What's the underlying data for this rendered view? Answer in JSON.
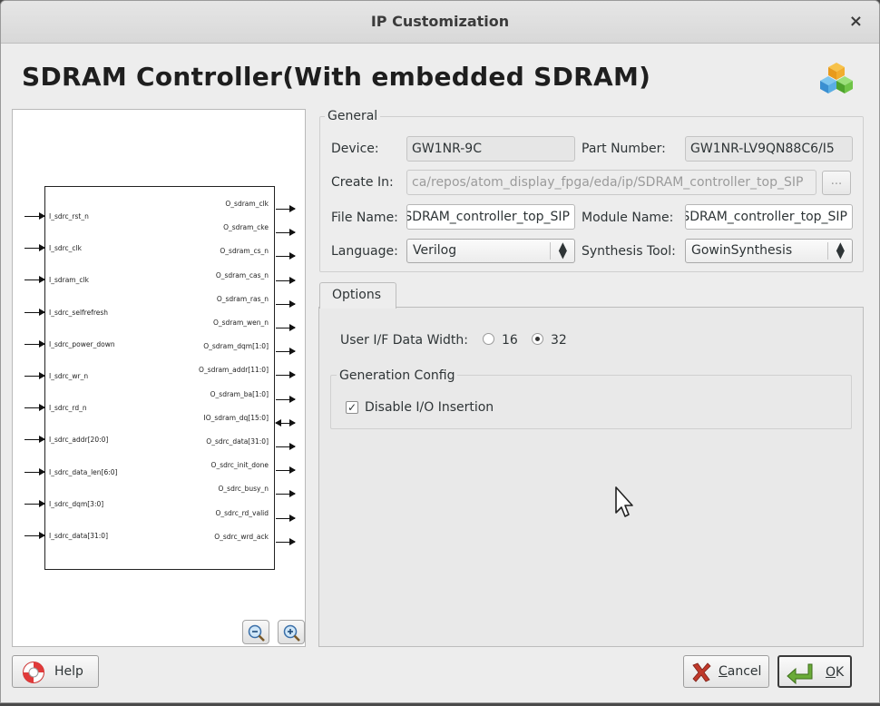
{
  "window": {
    "title": "IP Customization",
    "close": "×"
  },
  "heading": "SDRAM Controller(With embedded SDRAM)",
  "symbol": {
    "inputs": [
      "I_sdrc_rst_n",
      "I_sdrc_clk",
      "I_sdram_clk",
      "I_sdrc_selfrefresh",
      "I_sdrc_power_down",
      "I_sdrc_wr_n",
      "I_sdrc_rd_n",
      "I_sdrc_addr[20:0]",
      "I_sdrc_data_len[6:0]",
      "I_sdrc_dqm[3:0]",
      "I_sdrc_data[31:0]"
    ],
    "outputs": [
      "O_sdram_clk",
      "O_sdram_cke",
      "O_sdram_cs_n",
      "O_sdram_cas_n",
      "O_sdram_ras_n",
      "O_sdram_wen_n",
      "O_sdram_dqm[1:0]",
      "O_sdram_addr[11:0]",
      "O_sdram_ba[1:0]",
      "IO_sdram_dq[15:0]",
      "O_sdrc_data[31:0]",
      "O_sdrc_init_done",
      "O_sdrc_busy_n",
      "O_sdrc_rd_valid",
      "O_sdrc_wrd_ack"
    ]
  },
  "general": {
    "legend": "General",
    "device_label": "Device:",
    "device_value": "GW1NR-9C",
    "part_label": "Part Number:",
    "part_value": "GW1NR-LV9QN88C6/I5",
    "create_in_label": "Create In:",
    "create_in_value": "ca/repos/atom_display_fpga/eda/ip/SDRAM_controller_top_SIP",
    "browse_label": "...",
    "file_name_label": "File Name:",
    "file_name_value": "SDRAM_controller_top_SIP",
    "module_name_label": "Module Name:",
    "module_name_value": "SDRAM_controller_top_SIP",
    "language_label": "Language:",
    "language_value": "Verilog",
    "synthesis_label": "Synthesis Tool:",
    "synthesis_value": "GowinSynthesis"
  },
  "options": {
    "tab_label": "Options",
    "data_width_label": "User I/F Data Width:",
    "width_16": "16",
    "width_32": "32",
    "selected_width": "32",
    "gen_config_legend": "Generation Config",
    "disable_io_label": "Disable I/O Insertion",
    "disable_io_checked": true
  },
  "buttons": {
    "help": "Help",
    "cancel_mnemonic": "C",
    "cancel_rest": "ancel",
    "ok_mnemonic": "O",
    "ok_rest": "K"
  }
}
